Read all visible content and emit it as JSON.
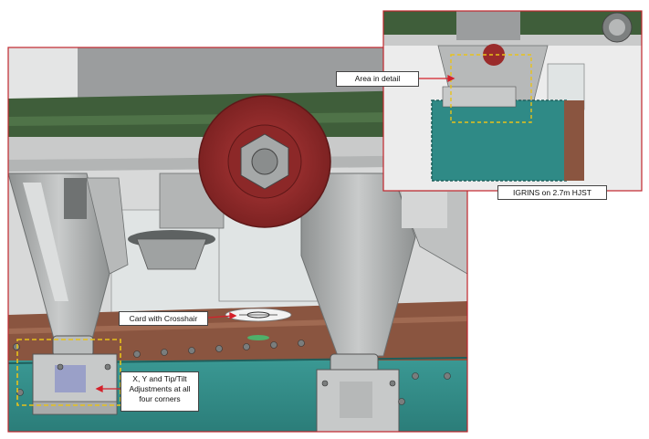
{
  "labels": {
    "area_in_detail": "Area in detail",
    "igrins": "IGRINS on 2.7m HJST",
    "card_crosshair": "Card with Crosshair",
    "adjustments": "X, Y and Tip/Tilt Adjustments at all four corners"
  },
  "colors": {
    "frame_border": "#c0262c",
    "callout_arrow": "#d4202a",
    "detail_highlight": "#e8c21a",
    "teal_enclosure": "#2f8a86",
    "green_telescope": "#3f5e3a",
    "copper_plate": "#8a5540",
    "red_wheel": "#9a2b2b",
    "grey_struts": "#a9abab"
  },
  "icons": [
    "screw-head-icon",
    "hex-nut-icon",
    "crosshair-target-icon"
  ]
}
